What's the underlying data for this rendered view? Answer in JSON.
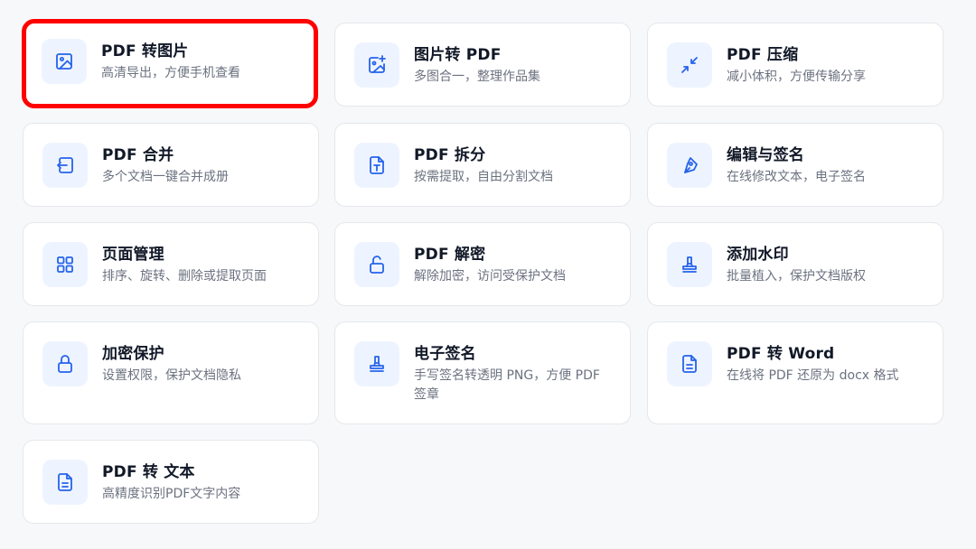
{
  "tools": [
    {
      "title": "PDF 转图片",
      "desc": "高清导出，方便手机查看",
      "icon": "image-icon",
      "selected": true
    },
    {
      "title": "图片转 PDF",
      "desc": "多图合一，整理作品集",
      "icon": "image-add-icon",
      "selected": false
    },
    {
      "title": "PDF 压缩",
      "desc": "减小体积，方便传输分享",
      "icon": "compress-icon",
      "selected": false
    },
    {
      "title": "PDF 合并",
      "desc": "多个文档一键合并成册",
      "icon": "merge-icon",
      "selected": false
    },
    {
      "title": "PDF 拆分",
      "desc": "按需提取，自由分割文档",
      "icon": "split-icon",
      "selected": false
    },
    {
      "title": "编辑与签名",
      "desc": "在线修改文本，电子签名",
      "icon": "pen-icon",
      "selected": false
    },
    {
      "title": "页面管理",
      "desc": "排序、旋转、删除或提取页面",
      "icon": "grid-icon",
      "selected": false
    },
    {
      "title": "PDF 解密",
      "desc": "解除加密，访问受保护文档",
      "icon": "unlock-icon",
      "selected": false
    },
    {
      "title": "添加水印",
      "desc": "批量植入，保护文档版权",
      "icon": "stamp-icon",
      "selected": false
    },
    {
      "title": "加密保护",
      "desc": "设置权限，保护文档隐私",
      "icon": "lock-icon",
      "selected": false
    },
    {
      "title": "电子签名",
      "desc": "手写签名转透明 PNG，方便 PDF 签章",
      "icon": "stamp-icon",
      "selected": false
    },
    {
      "title": "PDF 转 Word",
      "desc": "在线将 PDF 还原为 docx 格式",
      "icon": "document-icon",
      "selected": false
    },
    {
      "title": "PDF 转 文本",
      "desc": "高精度识别PDF文字内容",
      "icon": "document-icon",
      "selected": false
    }
  ],
  "colors": {
    "accent": "#2563eb",
    "icon_bg": "#eef4ff",
    "highlight": "#ff0000",
    "title": "#111827",
    "desc": "#6b7280"
  }
}
